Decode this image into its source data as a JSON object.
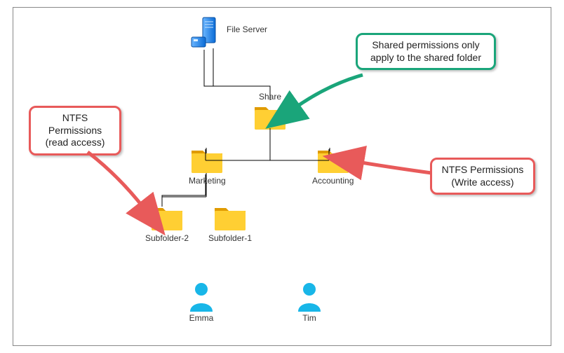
{
  "nodes": {
    "server": {
      "label": "File Server"
    },
    "share": {
      "label": "Share"
    },
    "marketing": {
      "label": "Marketing"
    },
    "accounting": {
      "label": "Accounting"
    },
    "subfolder1": {
      "label": "Subfolder-1"
    },
    "subfolder2": {
      "label": "Subfolder-2"
    },
    "emma": {
      "label": "Emma"
    },
    "tim": {
      "label": "Tim"
    }
  },
  "callouts": {
    "shared_perm": {
      "text": "Shared permissions only apply to the shared folder",
      "color": "#1aa57a"
    },
    "ntfs_read": {
      "text": "NTFS Permissions (read access)",
      "color": "#e85a5a"
    },
    "ntfs_write": {
      "text": "NTFS Permissions (Write access)",
      "color": "#e85a5a"
    }
  }
}
